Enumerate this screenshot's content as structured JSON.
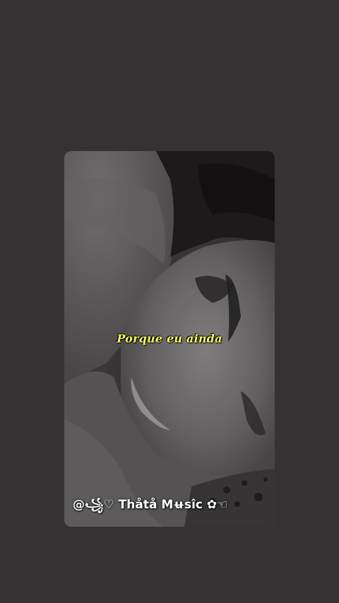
{
  "video": {
    "subtitle": "Porque eu ainda",
    "watermark": "@꧁♡ Thåtå Mʉsîc ✿☜"
  },
  "colors": {
    "background": "#353233",
    "subtitle": "#f2ff53",
    "watermark": "#ffffff"
  }
}
